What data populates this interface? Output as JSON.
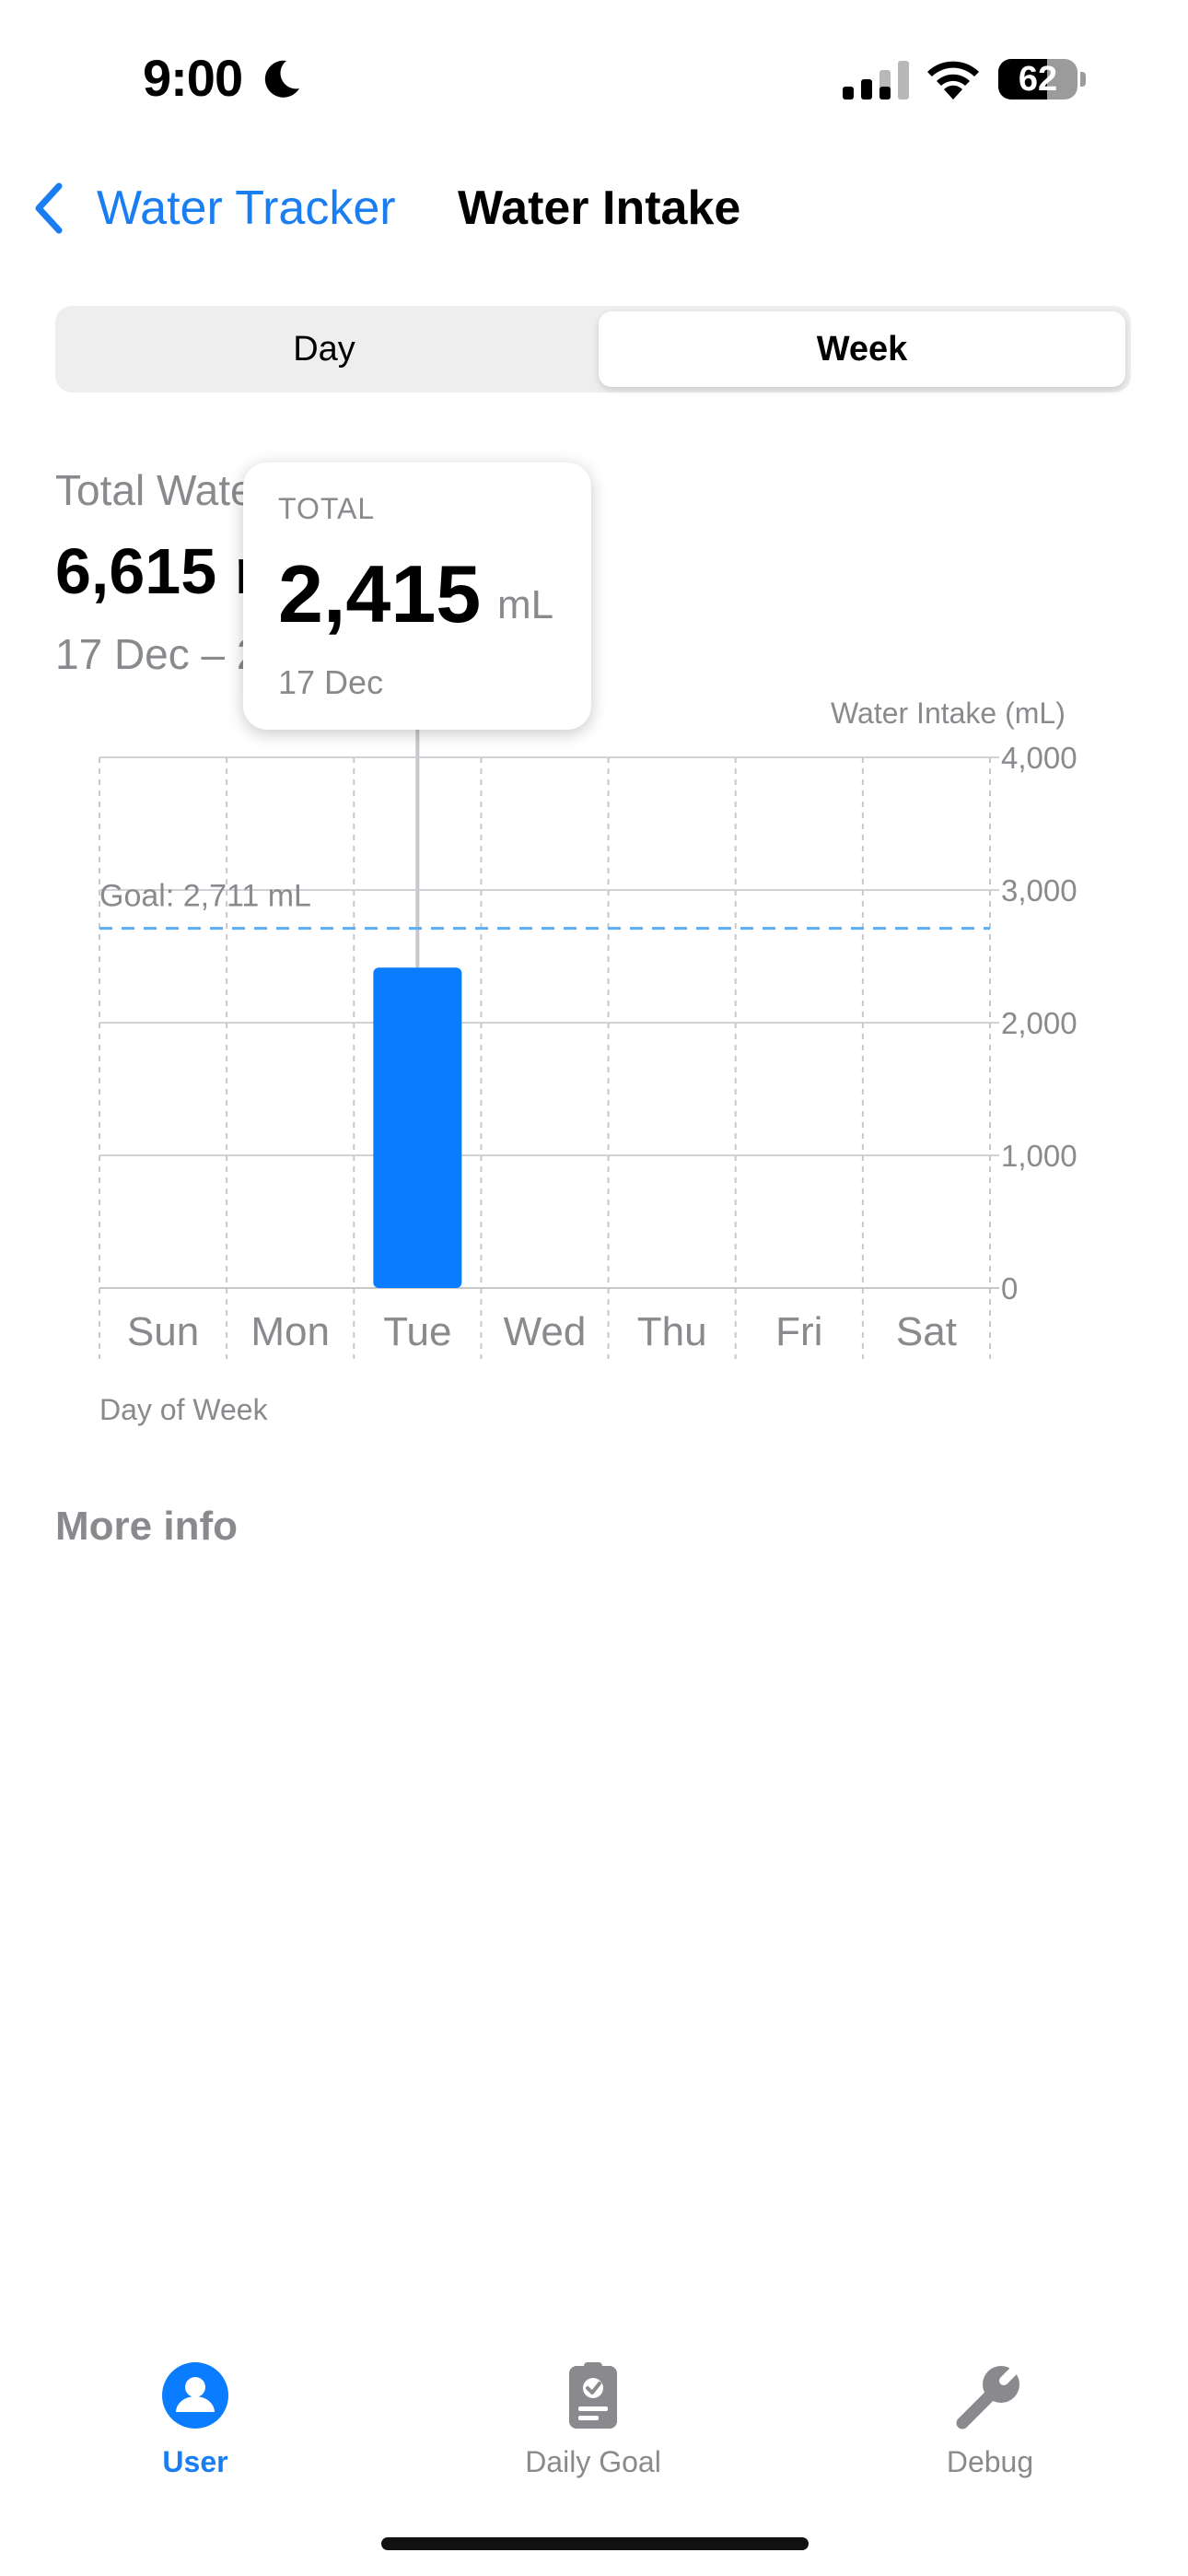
{
  "status_bar": {
    "time": "9:00",
    "battery_percent": "62",
    "battery_level": 0.62,
    "icons": [
      "moon-icon",
      "cellular-signal-icon",
      "wifi-icon",
      "battery-icon"
    ]
  },
  "nav": {
    "back_label": "Water Tracker",
    "title": "Water Intake"
  },
  "segmented": {
    "options": [
      "Day",
      "Week"
    ],
    "selected": "Week"
  },
  "summary": {
    "label": "Total Wate",
    "value": "6,615 r",
    "range": "17 Dec – 2"
  },
  "tooltip": {
    "label": "TOTAL",
    "value": "2,415",
    "unit": "mL",
    "date": "17 Dec"
  },
  "chart_data": {
    "type": "bar",
    "ylabel": "Water Intake (mL)",
    "xlabel": "Day of Week",
    "categories": [
      "Sun",
      "Mon",
      "Tue",
      "Wed",
      "Thu",
      "Fri",
      "Sat"
    ],
    "values": [
      0,
      0,
      2415,
      0,
      0,
      0,
      0
    ],
    "ylim": [
      0,
      4000
    ],
    "yticks": [
      0,
      1000,
      2000,
      3000,
      4000
    ],
    "ytick_labels": [
      "0",
      "1,000",
      "2,000",
      "3,000",
      "4,000"
    ],
    "goal": {
      "value": 2711,
      "label": "Goal: 2,711 mL"
    },
    "selected_category": "Tue",
    "grid": true,
    "bar_color": "#0a7cff",
    "goal_color": "#5aaef7"
  },
  "more_info": "More info",
  "tabs": [
    {
      "label": "User",
      "icon": "user-icon",
      "selected": true
    },
    {
      "label": "Daily Goal",
      "icon": "clipboard-check-icon",
      "selected": false
    },
    {
      "label": "Debug",
      "icon": "wrench-icon",
      "selected": false
    }
  ],
  "colors": {
    "accent": "#1a7ef2",
    "secondary_text": "#8a8a8e"
  }
}
